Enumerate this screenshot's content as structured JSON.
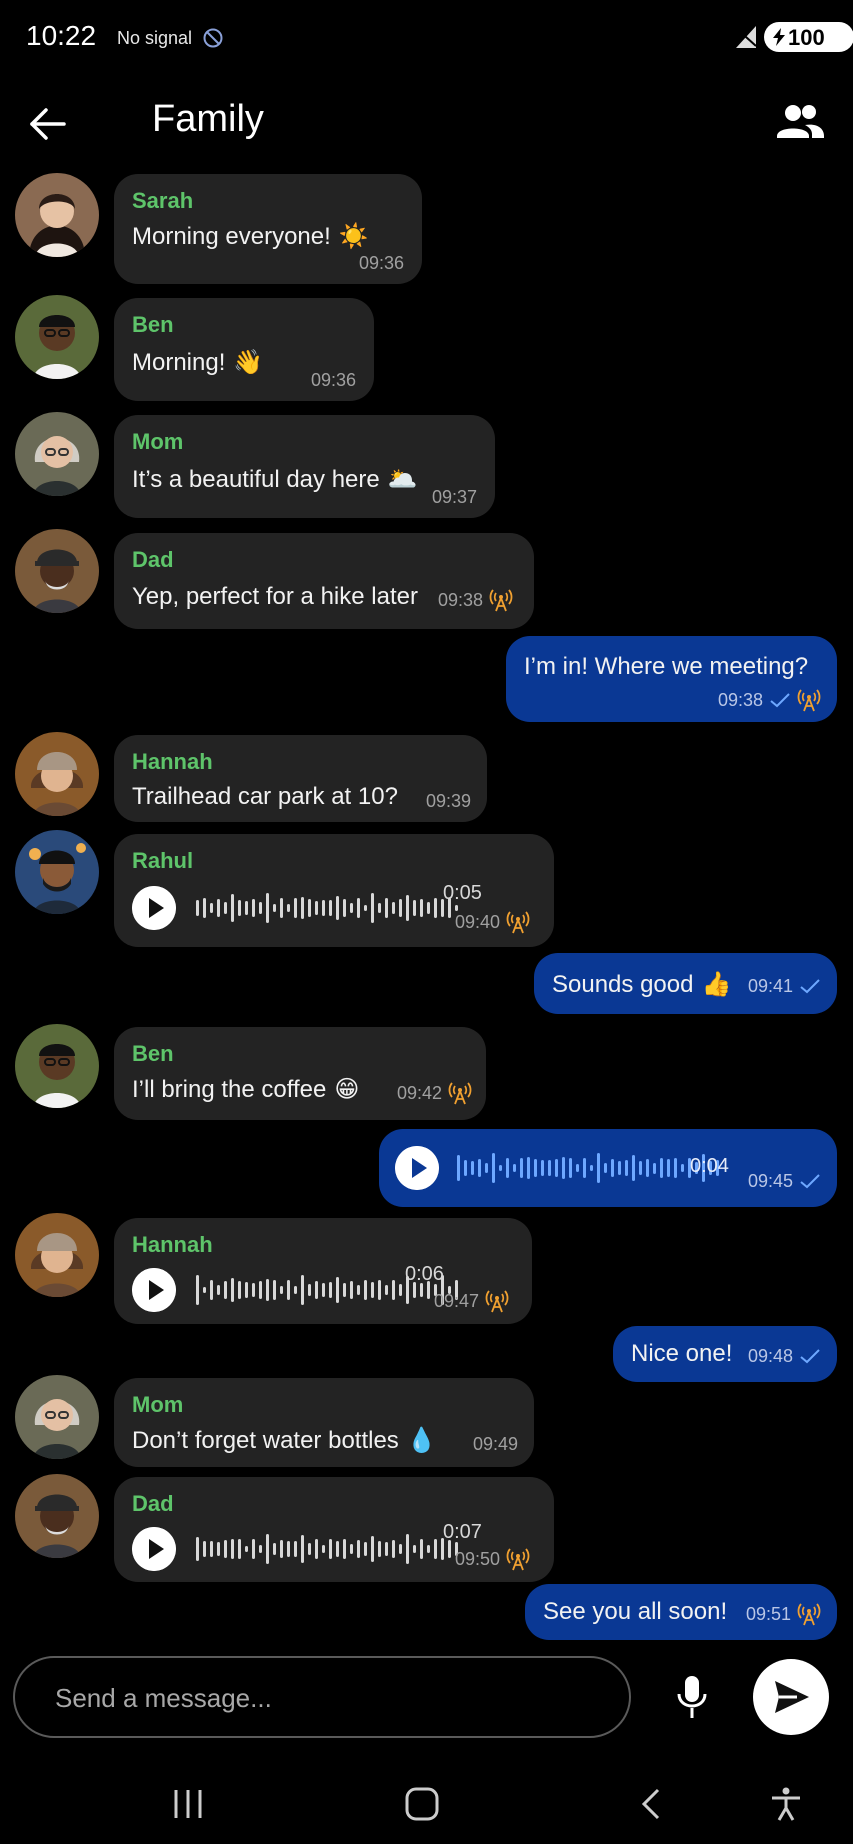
{
  "status_bar": {
    "time": "10:22",
    "signal_text": "No signal",
    "battery": "100",
    "icons": [
      "no-signal-icon",
      "cellular-icon",
      "battery-icon",
      "charging-bolt-icon"
    ]
  },
  "header": {
    "title": "Family",
    "icons": [
      "back-arrow-icon",
      "group-members-icon"
    ]
  },
  "colors": {
    "background": "#000000",
    "incoming_bubble": "#232323",
    "outgoing_bubble": "#0a3894",
    "sender_name": "#5ec46a",
    "tower_icon": "#f0a030"
  },
  "messages": [
    {
      "sender": "Sarah",
      "text": "Morning everyone!",
      "emoji": "☀️",
      "time": "09:36"
    },
    {
      "sender": "Ben",
      "text": "Morning!",
      "emoji": "👋",
      "time": "09:36"
    },
    {
      "sender": "Mom",
      "text": "It’s a beautiful day here",
      "emoji": "🌥️",
      "time": "09:37"
    },
    {
      "sender": "Dad",
      "text": "Yep, perfect for a hike later",
      "time": "09:38"
    },
    {
      "outgoing": true,
      "text": "I’m in! Where we meeting?",
      "time": "09:38"
    },
    {
      "sender": "Hannah",
      "text": "Trailhead car park at 10?",
      "time": "09:39"
    },
    {
      "sender": "Rahul",
      "voice_duration": "0:05",
      "time": "09:40"
    },
    {
      "outgoing": true,
      "text": "Sounds good",
      "emoji": "👍",
      "time": "09:41"
    },
    {
      "sender": "Ben",
      "text": "I’ll bring the coffee",
      "emoji": "😁",
      "time": "09:42"
    },
    {
      "outgoing": true,
      "voice_duration": "0:04",
      "time": "09:45"
    },
    {
      "sender": "Hannah",
      "voice_duration": "0:06",
      "time": "09:47"
    },
    {
      "outgoing": true,
      "text": "Nice one!",
      "time": "09:48"
    },
    {
      "sender": "Mom",
      "text": "Don’t forget water bottles",
      "emoji": "💧",
      "time": "09:49"
    },
    {
      "sender": "Dad",
      "voice_duration": "0:07",
      "time": "09:50"
    },
    {
      "outgoing": true,
      "text": "See you all soon!",
      "time": "09:51"
    }
  ],
  "composer": {
    "placeholder": "Send a message...",
    "icons": [
      "microphone-icon",
      "send-icon"
    ]
  },
  "nav_bar": {
    "icons": [
      "recent-apps-icon",
      "home-icon",
      "nav-back-icon",
      "accessibility-icon"
    ]
  }
}
